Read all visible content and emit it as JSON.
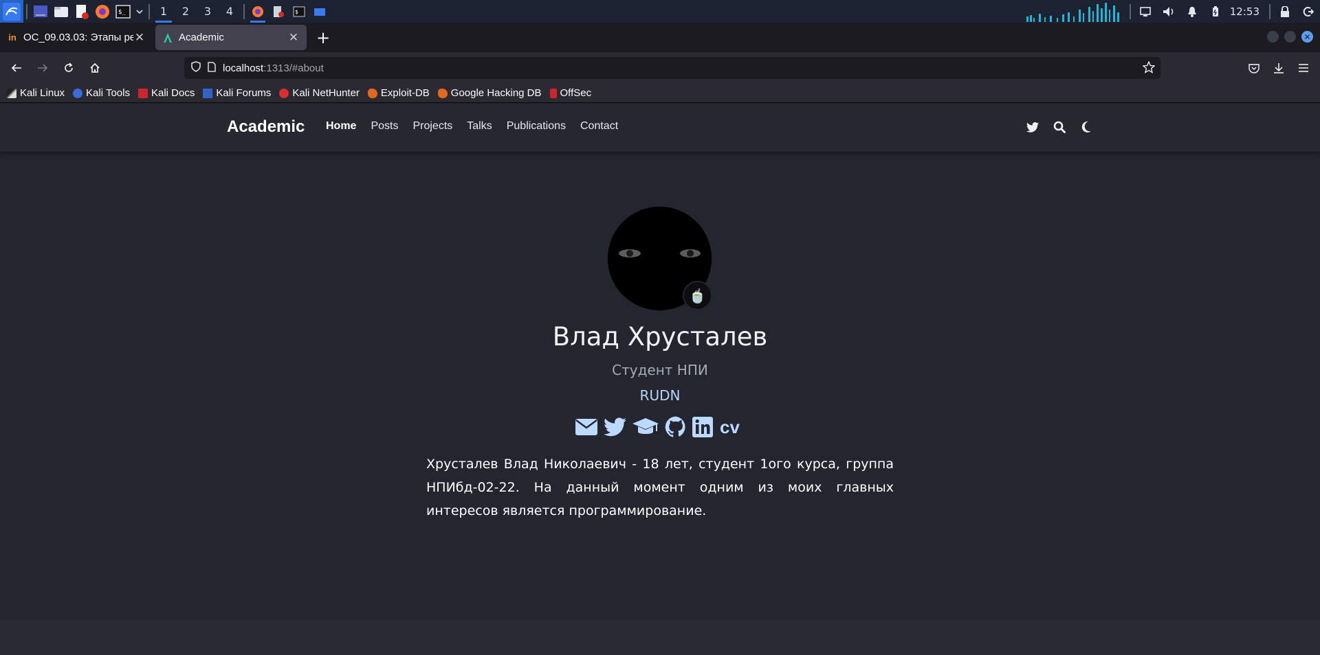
{
  "taskbar": {
    "workspaces": [
      "1",
      "2",
      "3",
      "4"
    ],
    "active_workspace": "1",
    "clock": "12:53",
    "icons": [
      "kali-menu-icon",
      "show-desktop-icon",
      "file-manager-icon",
      "text-editor-icon",
      "firefox-icon",
      "terminal-icon",
      "chevron-down-icon"
    ],
    "tray": [
      "display-icon",
      "volume-icon",
      "bell-icon",
      "battery-icon",
      "lock-icon",
      "logout-icon"
    ]
  },
  "tabs": [
    {
      "title": "ОС_09.03.03: Этапы реа",
      "favicon": "in",
      "active": false
    },
    {
      "title": "Academic",
      "favicon": "A",
      "active": true
    }
  ],
  "urlbar": {
    "host": "localhost",
    "rest": ":1313/#about"
  },
  "bookmarks": [
    "Kali Linux",
    "Kali Tools",
    "Kali Docs",
    "Kali Forums",
    "Kali NetHunter",
    "Exploit-DB",
    "Google Hacking DB",
    "OffSec"
  ],
  "site": {
    "brand": "Academic",
    "menu": [
      "Home",
      "Posts",
      "Projects",
      "Talks",
      "Publications",
      "Contact"
    ],
    "active_menu": "Home",
    "icons": [
      "twitter-icon",
      "search-icon",
      "moon-icon"
    ]
  },
  "profile": {
    "name": "Влад Хрусталев",
    "role": "Студент НПИ",
    "organization": "RUDN",
    "social": [
      "envelope-icon",
      "twitter-icon",
      "graduation-cap-icon",
      "github-icon",
      "linkedin-icon"
    ],
    "cv_label": "cv",
    "bio": "Хрусталев Влад Николаевич - 18 лет, студент 1ого курса, группа НПИбд-02-22. На данный момент одним из моих главных интересов является программирование."
  },
  "colors": {
    "accent": "#367bf0",
    "social_icon": "#bcd9ff",
    "page_bg": "#23252f"
  }
}
